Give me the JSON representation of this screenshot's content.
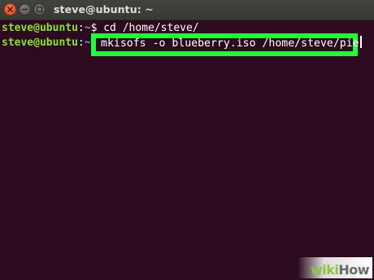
{
  "window": {
    "title": "steve@ubuntu: ~",
    "buttons": [
      "close",
      "minimize",
      "maximize"
    ]
  },
  "terminal": {
    "colors": {
      "background": "#2c0a1f",
      "user": "#8ae234",
      "path": "#729fcf",
      "text": "#ffffff",
      "highlight_border": "#22ff3a"
    },
    "lines": [
      {
        "user_host": "steve@ubuntu",
        "separator": ":",
        "path": "~",
        "prompt": "$ ",
        "command": "cd /home/steve/"
      },
      {
        "user_host": "steve@ubuntu",
        "separator": ":",
        "path": "~",
        "prompt": "$ ",
        "command": "mkisofs -o blueberry.iso /home/steve/pie"
      }
    ]
  },
  "watermark": {
    "part1": "wiki",
    "part2": "How"
  }
}
